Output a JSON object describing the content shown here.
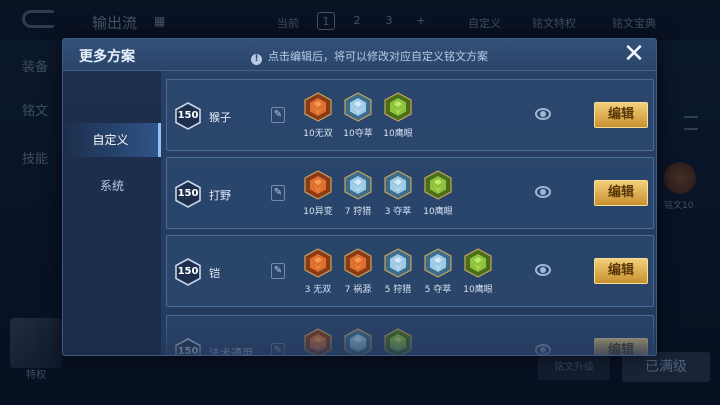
{
  "background": {
    "title": "输出流",
    "current_label": "当前",
    "pages": [
      "1",
      "2",
      "3",
      "+"
    ],
    "custom": "自定义",
    "rune_perm": "铭文特权",
    "rune_book": "铭文宝典",
    "side_items": [
      "装备",
      "铭文",
      "技能"
    ],
    "avatar_label": "特权",
    "right_icon_label": "铭文10",
    "bottom_button": "已满级",
    "bottom_button2": "铭文升级"
  },
  "modal": {
    "title": "更多方案",
    "hint": "点击编辑后，将可以修改对应自定义铭文方案",
    "close": "✕",
    "tabs": [
      {
        "label": "自定义",
        "active": true
      },
      {
        "label": "系统",
        "active": false
      }
    ],
    "edit_label": "编辑",
    "plans": [
      {
        "level": "150",
        "name": "猴子",
        "runes": [
          {
            "label": "10无双",
            "kind": "red"
          },
          {
            "label": "10夺萃",
            "kind": "blue"
          },
          {
            "label": "10鹰眼",
            "kind": "green"
          }
        ]
      },
      {
        "level": "150",
        "name": "打野",
        "runes": [
          {
            "label": "10异变",
            "kind": "red"
          },
          {
            "label": "7 狩猎",
            "kind": "blue"
          },
          {
            "label": "3 夺萃",
            "kind": "blue"
          },
          {
            "label": "10鹰眼",
            "kind": "green"
          }
        ]
      },
      {
        "level": "150",
        "name": "铠",
        "runes": [
          {
            "label": "3 无双",
            "kind": "red"
          },
          {
            "label": "7 祸源",
            "kind": "red"
          },
          {
            "label": "5 狩猎",
            "kind": "blue"
          },
          {
            "label": "5 夺萃",
            "kind": "blue"
          },
          {
            "label": "10鹰眼",
            "kind": "green"
          }
        ]
      },
      {
        "level": "150",
        "name": "法术通用",
        "runes": [
          {
            "label": "",
            "kind": "red"
          },
          {
            "label": "",
            "kind": "blue"
          },
          {
            "label": "",
            "kind": "green"
          }
        ]
      }
    ]
  },
  "colors": {
    "accent_gold": "#e2b45a",
    "red_rune": "#d0622a",
    "blue_rune": "#8fc1e0",
    "green_rune": "#8fbf3a"
  }
}
